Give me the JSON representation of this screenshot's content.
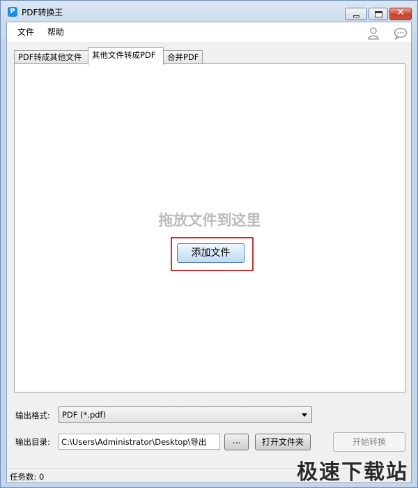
{
  "window": {
    "title": "PDF转换王",
    "app_icon_glyph": "P"
  },
  "menu": {
    "file": "文件",
    "help": "帮助"
  },
  "tabs": [
    {
      "label": "PDF转成其他文件",
      "active": false
    },
    {
      "label": "其他文件转成PDF",
      "active": true
    },
    {
      "label": "合并PDF",
      "active": false
    }
  ],
  "panel": {
    "drop_hint": "拖放文件到这里",
    "add_button": "添加文件"
  },
  "output": {
    "format_label": "输出格式:",
    "format_value": "PDF (*.pdf)",
    "dir_label": "输出目录:",
    "dir_value": "C:\\Users\\Administrator\\Desktop\\导出",
    "browse_button": "...",
    "open_folder_button": "打开文件夹",
    "start_button": "开始转换"
  },
  "status": {
    "task_count": "任务数: 0"
  },
  "watermark": "极速下载站",
  "colors": {
    "highlight_border": "#d32f2f",
    "accent": "#1a8fe0"
  },
  "icons": [
    "user-icon",
    "chat-icon",
    "minimize-icon",
    "maximize-icon",
    "close-icon"
  ]
}
